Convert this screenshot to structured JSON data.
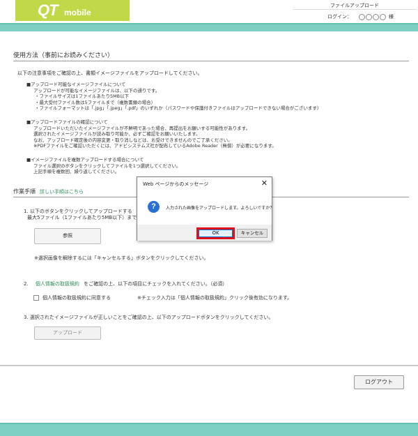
{
  "header": {
    "logo_main": "QT",
    "logo_sub": "mobile",
    "page_name": "ファイルアップロード",
    "login_label": "ログイン：",
    "login_suffix": "様"
  },
  "usage": {
    "title": "使用方法（事前にお読みください）",
    "intro": "以下の注意事項をご確認の上、書類イメージファイルをアップロードしてください。",
    "notes": [
      {
        "heading": "■アップロード可能なイメージファイルについて",
        "lines": [
          "アップロードが可能なイメージファイルは、以下の通りです。",
          "・ファイルサイズは1ファイルあたり5MB以下",
          "・最大受付ファイル数は5ファイルまで（複数書類の場合）",
          "・ファイルフォーマットは「.jpg」「.jpeg」「.pdf」のいずれか（パスワードや保護付きファイルはアップロードできない場合がございます）"
        ]
      },
      {
        "heading": "■アップロードファイルの確認について",
        "lines": [
          "アップロードいただいたイメージファイルが不鮮明であった場合、再提出をお願いする可能性があります。",
          "選択されたイメージファイルが読み取り可能か、必ずご確認をお願いいたします。",
          "なお、アップロード確定後の内容変更・取り消しなどは、お受けできませんのでご了承ください。",
          "※PDFファイルをご確認いただくには、アドビシステムズ社が配布しているAdobe Reader（無償）が必要になります。"
        ]
      },
      {
        "heading": "■イメージファイルを複数アップロードする場合について",
        "lines": [
          "ファイル選択のボタンをクリックしてファイルを1つ選択してください。",
          "上記手順を複数回、繰り返してください。"
        ]
      }
    ]
  },
  "procedure": {
    "title": "作業手順",
    "link": "詳しい手順はこちら",
    "step1_line1": "1. 以下のボタンをクリックしてアップロードする",
    "step1_line2": "最大5ファイル（1ファイルあたり5MB以下）まで",
    "browse_label": "参照",
    "cancel_note": "※選択画像を解除するには「キャンセルする」ボタンをクリックしてください。",
    "step2_num": "2.",
    "step2_link": "個人情報の取扱規約",
    "step2_text": "をご確認の上、以下の項目にチェックを入れてください。（必須）",
    "agree_label": "個人情報の取扱規約に同意する",
    "agree_note": "※チェック入力は「個人情報の取扱規約」クリック後有効になります。",
    "step3_text": "3. 選択されたイメージファイルが正しいことをご確認の上、以下のアップロードボタンをクリックしてください。",
    "upload_label": "アップロード"
  },
  "logout_label": "ログアウト",
  "dialog": {
    "title": "Web ページからのメッセージ",
    "close": "✕",
    "icon": "?",
    "message": "入力された画像をアップロードします。よろしいですか？",
    "ok_label": "OK",
    "cancel_label": "キャンセル"
  }
}
